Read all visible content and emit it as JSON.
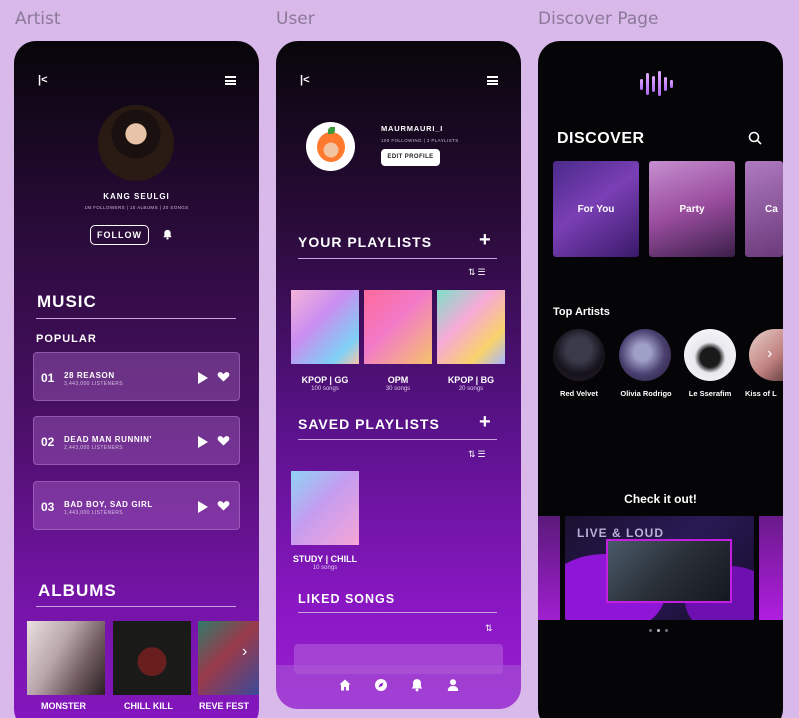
{
  "frames": {
    "artist_label": "Artist",
    "user_label": "User",
    "discover_label": "Discover Page"
  },
  "artist": {
    "name": "KANG SEULGI",
    "stats": "1M FOLLOWERS | 10 ALBUMS | 20 SONGS",
    "follow_label": "FOLLOW",
    "music_heading": "MUSIC",
    "popular_heading": "POPULAR",
    "songs": [
      {
        "num": "01",
        "title": "28 REASON",
        "listeners": "3,443,000 LISTENERS"
      },
      {
        "num": "02",
        "title": "DEAD MAN RUNNIN'",
        "listeners": "2,443,000 LISTENERS"
      },
      {
        "num": "03",
        "title": "BAD BOY, SAD GIRL",
        "listeners": "1,443,000 LISTENERS"
      }
    ],
    "albums_heading": "ALBUMS",
    "albums": [
      "MONSTER",
      "CHILL KILL",
      "REVE FEST"
    ]
  },
  "user": {
    "username": "MAURMAURI_I",
    "stats": "100 FOLLOWING | 3 PLAYLISTS",
    "edit_label": "EDIT PROFILE",
    "your_playlists_heading": "YOUR PLAYLISTS",
    "playlists": [
      {
        "name": "KPOP | GG",
        "count": "100 songs"
      },
      {
        "name": "OPM",
        "count": "30 songs"
      },
      {
        "name": "KPOP | BG",
        "count": "20 songs"
      }
    ],
    "saved_heading": "SAVED PLAYLISTS",
    "saved": [
      {
        "name": "STUDY | CHILL",
        "count": "10 songs"
      }
    ],
    "liked_heading": "LIKED SONGS"
  },
  "discover": {
    "title": "DISCOVER",
    "genres": [
      "For You",
      "Party",
      "Ca"
    ],
    "top_artists_heading": "Top Artists",
    "artists": [
      "Red Velvet",
      "Olivia Rodrigo",
      "Le Sserafim",
      "Kiss of L"
    ],
    "check_heading": "Check it out!",
    "banner_text": "LIVE & LOUD"
  },
  "colors": {
    "accent": "#8516bf",
    "background": "#d9b8ea",
    "card": "#b06ecd"
  }
}
